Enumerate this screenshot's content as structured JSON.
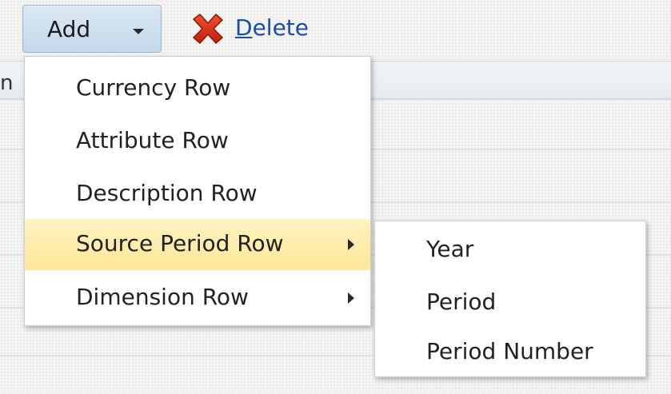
{
  "toolbar": {
    "add_label": "Add",
    "delete_label": "Delete",
    "delete_mnemonic": "D",
    "delete_rest": "elete",
    "delete_icon": "red-x-icon"
  },
  "table": {
    "header_fragment": "n"
  },
  "menu": {
    "items": [
      {
        "label": "Currency Row",
        "has_submenu": false
      },
      {
        "label": "Attribute Row",
        "has_submenu": false
      },
      {
        "label": "Description Row",
        "has_submenu": false
      },
      {
        "label": "Source Period Row",
        "has_submenu": true,
        "highlighted": true
      },
      {
        "label": "Dimension Row",
        "has_submenu": true
      }
    ]
  },
  "submenu": {
    "items": [
      {
        "label": "Year"
      },
      {
        "label": "Period"
      },
      {
        "label": "Period Number"
      }
    ]
  },
  "colors": {
    "highlight": "#fde79a",
    "link": "#1a4fa8",
    "button_bg": "#c4d8ea",
    "delete_icon": "#d42a16"
  }
}
